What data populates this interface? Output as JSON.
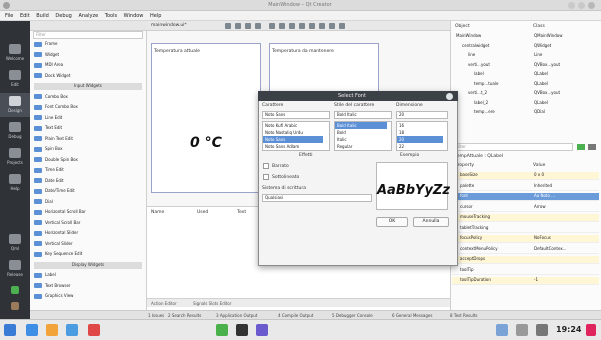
{
  "window": {
    "title": "MainWindow – Qt Creator"
  },
  "menu": [
    "File",
    "Edit",
    "Build",
    "Debug",
    "Analyze",
    "Tools",
    "Window",
    "Help"
  ],
  "modes": [
    {
      "label": "Welcome",
      "icon": "grid-icon"
    },
    {
      "label": "Edit",
      "icon": "edit-icon"
    },
    {
      "label": "Design",
      "icon": "design-icon"
    },
    {
      "label": "Debug",
      "icon": "bug-icon"
    },
    {
      "label": "Projects",
      "icon": "wrench-icon"
    },
    {
      "label": "Help",
      "icon": "help-icon"
    },
    {
      "label": "Qml",
      "icon": "monitor-icon"
    },
    {
      "label": "Release",
      "icon": "monitor-icon"
    }
  ],
  "editor": {
    "tab": "mainwindow.ui*"
  },
  "widgetbox": {
    "filter_placeholder": "Filter",
    "items": [
      {
        "t": "item",
        "label": "Frame"
      },
      {
        "t": "item",
        "label": "Widget"
      },
      {
        "t": "item",
        "label": "MDI Area"
      },
      {
        "t": "item",
        "label": "Dock Widget"
      },
      {
        "t": "cat",
        "label": "Input Widgets"
      },
      {
        "t": "item",
        "label": "Combo Box"
      },
      {
        "t": "item",
        "label": "Font Combo Box"
      },
      {
        "t": "item",
        "label": "Line Edit"
      },
      {
        "t": "item",
        "label": "Text Edit"
      },
      {
        "t": "item",
        "label": "Plain Text Edit"
      },
      {
        "t": "item",
        "label": "Spin Box"
      },
      {
        "t": "item",
        "label": "Double Spin Box"
      },
      {
        "t": "item",
        "label": "Time Edit"
      },
      {
        "t": "item",
        "label": "Date Edit"
      },
      {
        "t": "item",
        "label": "Date/Time Edit"
      },
      {
        "t": "item",
        "label": "Dial"
      },
      {
        "t": "item",
        "label": "Horizontal Scroll Bar"
      },
      {
        "t": "item",
        "label": "Vertical Scroll Bar"
      },
      {
        "t": "item",
        "label": "Horizontal Slider"
      },
      {
        "t": "item",
        "label": "Vertical Slider"
      },
      {
        "t": "item",
        "label": "Key Sequence Edit"
      },
      {
        "t": "cat",
        "label": "Display Widgets"
      },
      {
        "t": "item",
        "label": "Label"
      },
      {
        "t": "item",
        "label": "Text Browser"
      },
      {
        "t": "item",
        "label": "Graphics View"
      }
    ]
  },
  "form": {
    "pane1_label": "Temperatura attuale",
    "pane2_label": "Temperatura da mantenere",
    "temp_value": "0 °C"
  },
  "lower": {
    "col1": "Name",
    "col2": "Used",
    "col3": "Text"
  },
  "lower_tabs": [
    "Action Editor",
    "Signals Slots Editor"
  ],
  "output_tabs": [
    "1 Issues",
    "2 Search Results",
    "3 Application Output",
    "4 Compile Output",
    "5 Debugger Console",
    "6 General Messages",
    "8 Test Results"
  ],
  "dialog": {
    "title": "Select Font",
    "font_label": "Carattere",
    "style_label": "Stile del carattere",
    "size_label": "Dimensione",
    "font_value": "Noto Sans",
    "style_value": "Bold Italic",
    "size_value": "20",
    "fonts": [
      "Noto Kufi Arabic",
      "Noto Nastaliq Urdu",
      "Noto Sans",
      "Noto Sans Adlam"
    ],
    "styles": [
      "Bold Italic",
      "Bold",
      "Italic",
      "Regular"
    ],
    "sizes": [
      "16",
      "18",
      "20",
      "22"
    ],
    "effects_label": "Effetti",
    "strike_label": "Barrato",
    "underline_label": "Sottolineato",
    "writing_label": "Sistema di scrittura",
    "writing_value": "Qualsiasi",
    "sample_label": "Esempio",
    "sample_text": "AaBbYyZz",
    "ok_label": "OK",
    "cancel_label": "Annulla"
  },
  "objects": {
    "header_object": "Object",
    "header_class": "Class",
    "rows": [
      {
        "o": "MainWindow",
        "c": "QMainWindow"
      },
      {
        "o": "centralwidget",
        "c": "QWidget"
      },
      {
        "o": "line",
        "c": "Line"
      },
      {
        "o": "verti...yout",
        "c": "QVBox...yout"
      },
      {
        "o": "label",
        "c": "QLabel"
      },
      {
        "o": "temp...tuale",
        "c": "QLabel"
      },
      {
        "o": "verti...t_2",
        "c": "QVBox...yout"
      },
      {
        "o": "label_2",
        "c": "QLabel"
      },
      {
        "o": "temp...ere",
        "c": "QDial"
      }
    ]
  },
  "props": {
    "filter_placeholder": "Filter",
    "context": "tempAttuale : QLabel",
    "header_prop": "Property",
    "header_val": "Value",
    "rows": [
      {
        "p": "baseSize",
        "v": "0 x 0"
      },
      {
        "p": "palette",
        "v": "Inherited"
      },
      {
        "p": "font",
        "v": "Aa Noto ...",
        "sel": true
      },
      {
        "p": "cursor",
        "v": "Arrow"
      },
      {
        "p": "mouseTracking",
        "v": ""
      },
      {
        "p": "tabletTracking",
        "v": ""
      },
      {
        "p": "focusPolicy",
        "v": "NoFocus"
      },
      {
        "p": "contextMenuPolicy",
        "v": "DefaultContex..."
      },
      {
        "p": "acceptDrops",
        "v": ""
      },
      {
        "p": "toolTip",
        "v": ""
      },
      {
        "p": "toolTipDuration",
        "v": "-1"
      }
    ]
  },
  "clock": "19:24"
}
